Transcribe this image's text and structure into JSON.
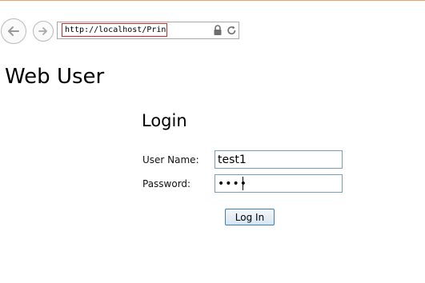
{
  "browser": {
    "url": "http://localhost/PrintJob",
    "icons": [
      "back-arrow-icon",
      "forward-arrow-icon",
      "lock-icon",
      "refresh-icon"
    ]
  },
  "page": {
    "site_title": "Web User",
    "login_title": "Login",
    "form": {
      "username_label": "User Name:",
      "username_value": "test1",
      "password_label": "Password:",
      "password_value": "test",
      "submit_label": "Log In"
    }
  }
}
